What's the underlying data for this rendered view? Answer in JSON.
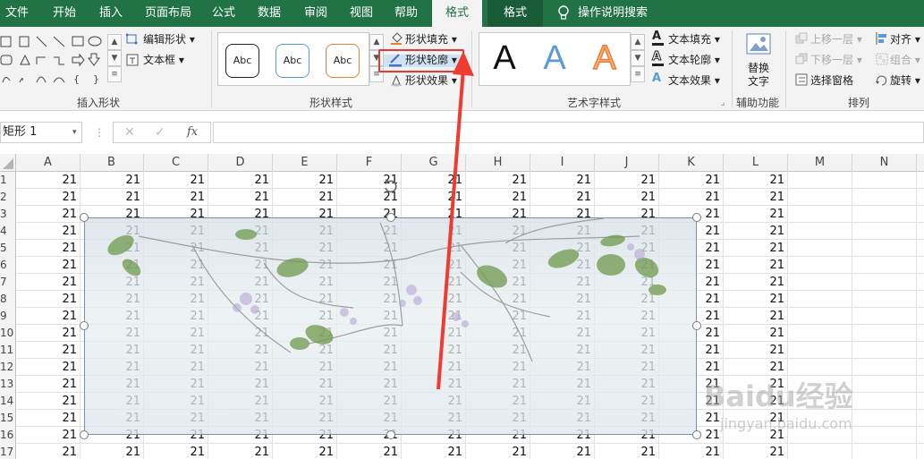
{
  "menu": {
    "items": [
      "文件",
      "开始",
      "插入",
      "页面布局",
      "公式",
      "数据",
      "审阅",
      "视图",
      "帮助",
      "格式",
      "格式"
    ],
    "search": "操作说明搜索"
  },
  "ribbon": {
    "insert_shapes": {
      "edit_shape": "编辑形状",
      "text_box": "文本框",
      "label": "插入形状"
    },
    "shape_styles": {
      "sample": "Abc",
      "fill": "形状填充",
      "outline": "形状轮廓",
      "effect": "形状效果",
      "label": "形状样式"
    },
    "wordart": {
      "letter": "A",
      "text_fill": "文本填充",
      "text_outline": "文本轮廓",
      "text_effect": "文本效果",
      "label": "艺术字样式"
    },
    "accessibility": {
      "alt_text_line1": "替换",
      "alt_text_line2": "文字",
      "label": "辅助功能"
    },
    "arrange": {
      "bring_forward": "上移一层",
      "send_backward": "下移一层",
      "selection_pane": "选择窗格",
      "align": "对齐",
      "group": "组合",
      "rotate": "旋转",
      "label": "排列"
    }
  },
  "formula_bar": {
    "name_box": "矩形 1",
    "fx": "fx",
    "value": ""
  },
  "columns": [
    "A",
    "B",
    "C",
    "D",
    "E",
    "F",
    "G",
    "H",
    "I",
    "J",
    "K",
    "L",
    "M",
    "N"
  ],
  "rows": [
    "1",
    "2",
    "3",
    "4",
    "5",
    "6",
    "7",
    "8",
    "9",
    "10",
    "11",
    "12",
    "13",
    "14",
    "15",
    "16",
    "17"
  ],
  "cell_value": "21",
  "watermark": {
    "brand": "Baidu经验",
    "url": "jingyan.baidu.com"
  },
  "colors": {
    "excel_green": "#217346",
    "highlight_red": "#e53935",
    "arrow_red": "#f03c30"
  }
}
